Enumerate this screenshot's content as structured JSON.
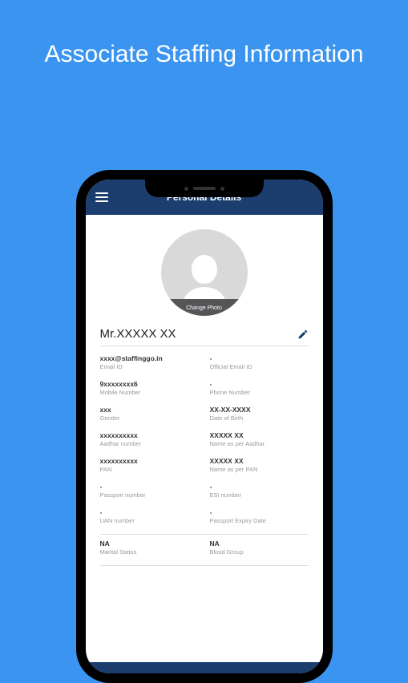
{
  "page": {
    "title": "Associate Staffing Information"
  },
  "header": {
    "title": "Personal Details"
  },
  "avatar": {
    "change_label": "Change Photo"
  },
  "profile": {
    "name": "Mr.XXXXX XX"
  },
  "fields": [
    {
      "value": "xxxx@staffinggo.in",
      "label": "Email ID"
    },
    {
      "value": "-",
      "label": "Official Email ID"
    },
    {
      "value": "9xxxxxxxx6",
      "label": "Mobile Number"
    },
    {
      "value": "-",
      "label": "Phone Number"
    },
    {
      "value": "xxx",
      "label": "Gender"
    },
    {
      "value": "XX-XX-XXXX",
      "label": "Date of Birth"
    },
    {
      "value": "xxxxxxxxxx",
      "label": "Aadhar number"
    },
    {
      "value": "XXXXX XX",
      "label": "Name as per Aadhar"
    },
    {
      "value": "xxxxxxxxxx",
      "label": "PAN"
    },
    {
      "value": "XXXXX XX",
      "label": "Name as per PAN"
    },
    {
      "value": "-",
      "label": "Passport number"
    },
    {
      "value": "-",
      "label": "ESI number"
    },
    {
      "value": "-",
      "label": "UAN number"
    },
    {
      "value": "-",
      "label": "Passport Expiry Date"
    },
    {
      "value": "NA",
      "label": "Marital Status"
    },
    {
      "value": "NA",
      "label": "Blood Group"
    }
  ]
}
